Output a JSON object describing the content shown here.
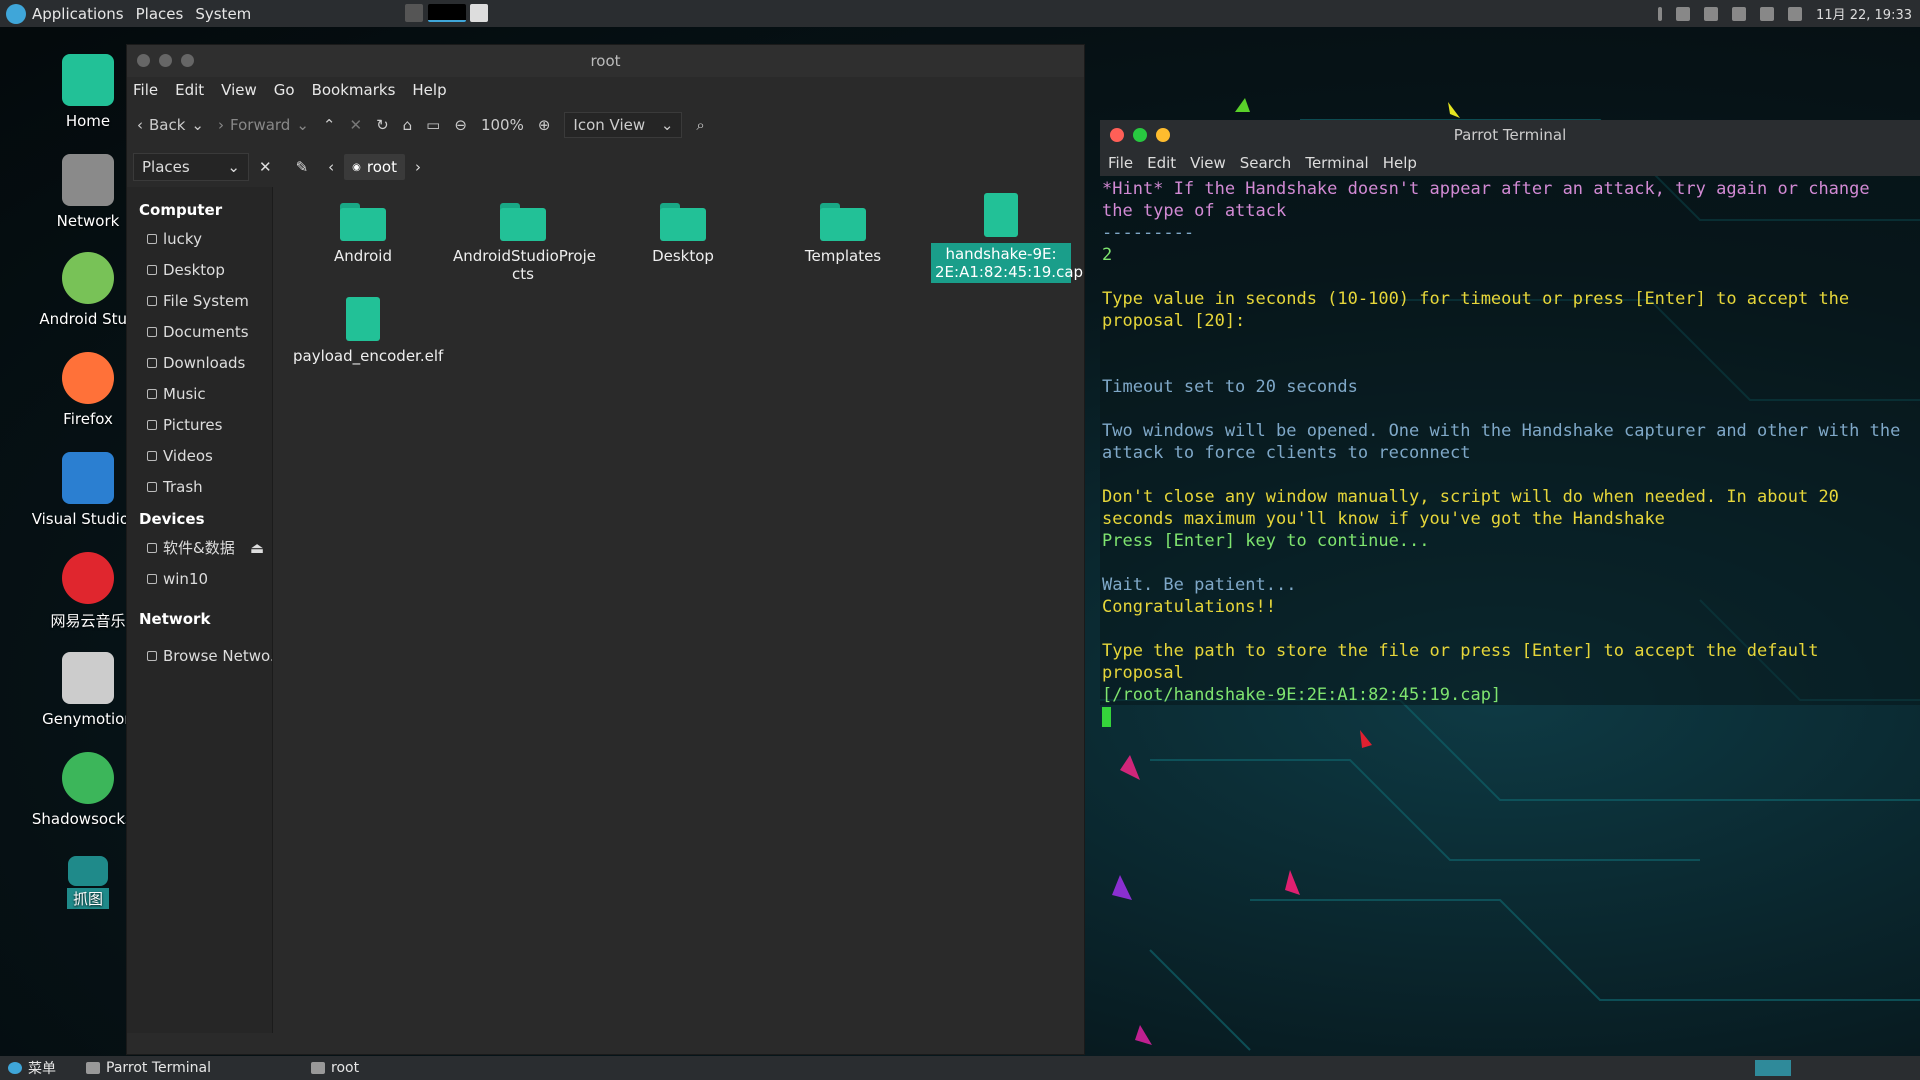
{
  "top_panel": {
    "menus": [
      "Applications",
      "Places",
      "System"
    ],
    "datetime": "11月 22, 19:33"
  },
  "desktop_icons": [
    {
      "label": "Home",
      "icon": "home-icon",
      "color": "#22c197"
    },
    {
      "label": "Network",
      "icon": "network-icon",
      "color": "#8a8a8a"
    },
    {
      "label": "Android Stud",
      "icon": "android-studio-icon",
      "color": "#78c257"
    },
    {
      "label": "Firefox",
      "icon": "firefox-icon",
      "color": "#ff7139"
    },
    {
      "label": "Visual Studio C",
      "icon": "vscode-icon",
      "color": "#2b7fd1"
    },
    {
      "label": "网易云音乐",
      "icon": "netease-music-icon",
      "color": "#e0262e"
    },
    {
      "label": "Genymotion",
      "icon": "genymotion-icon",
      "color": "#cccccc"
    },
    {
      "label": "Shadowsocks-(",
      "icon": "shadowsocks-icon",
      "color": "#3cb65a"
    },
    {
      "label": "抓图",
      "icon": "screenshot-icon",
      "color": "#1f8a8a"
    }
  ],
  "file_manager": {
    "title": "root",
    "menus": [
      "File",
      "Edit",
      "View",
      "Go",
      "Bookmarks",
      "Help"
    ],
    "toolbar": {
      "back": "Back",
      "forward": "Forward",
      "zoom": "100%",
      "view_mode": "Icon View"
    },
    "places_select": "Places",
    "breadcrumb": "root",
    "sidebar": {
      "computer_header": "Computer",
      "computer_items": [
        "lucky",
        "Desktop",
        "File System",
        "Documents",
        "Downloads",
        "Music",
        "Pictures",
        "Videos",
        "Trash"
      ],
      "devices_header": "Devices",
      "device_items": [
        "软件&数据",
        "win10"
      ],
      "network_header": "Network",
      "network_items": [
        "Browse Netwo..."
      ]
    },
    "files": [
      {
        "name": "Android",
        "type": "folder"
      },
      {
        "name": "AndroidStudioProje cts",
        "type": "folder"
      },
      {
        "name": "Desktop",
        "type": "folder"
      },
      {
        "name": "Templates",
        "type": "folder"
      },
      {
        "name": "handshake-9E: 2E:A1:82:45:19.cap",
        "type": "file",
        "selected": true
      },
      {
        "name": "payload_encoder.elf",
        "type": "file"
      }
    ]
  },
  "terminal": {
    "title": "Parrot Terminal",
    "menus": [
      "File",
      "Edit",
      "View",
      "Search",
      "Terminal",
      "Help"
    ],
    "lines": [
      {
        "text": "*Hint* If the Handshake doesn't appear after an attack, try again or change the type of attack",
        "color": "pink"
      },
      {
        "text": "---------",
        "color": "blue"
      },
      {
        "text": "2",
        "color": "green"
      },
      {
        "text": "",
        "color": "blue"
      },
      {
        "text": "Type value in seconds (10-100) for timeout or press [Enter] to accept the proposal [20]:",
        "color": "yellow"
      },
      {
        "text": "",
        "color": "blue"
      },
      {
        "text": "",
        "color": "blue"
      },
      {
        "text": "Timeout set to 20 seconds",
        "color": "blue"
      },
      {
        "text": "",
        "color": "blue"
      },
      {
        "text": "Two windows will be opened. One with the Handshake capturer and other with the attack to force clients to reconnect",
        "color": "blue"
      },
      {
        "text": "",
        "color": "blue"
      },
      {
        "text": "Don't close any window manually, script will do when needed. In about 20 seconds maximum you'll know if you've got the Handshake",
        "color": "yellow"
      },
      {
        "text": "Press [Enter] key to continue...",
        "color": "green"
      },
      {
        "text": "",
        "color": "blue"
      },
      {
        "text": "Wait. Be patient...",
        "color": "blue"
      },
      {
        "text": "Congratulations!!",
        "color": "yellow"
      },
      {
        "text": "",
        "color": "blue"
      },
      {
        "text": "Type the path to store the file or press [Enter] to accept the default proposal",
        "color": "yellow"
      },
      {
        "text": "[/root/handshake-9E:2E:A1:82:45:19.cap]",
        "color": "green"
      }
    ]
  },
  "bottom_panel": {
    "menu_label": "菜单",
    "tasks": [
      "Parrot Terminal",
      "root"
    ]
  }
}
